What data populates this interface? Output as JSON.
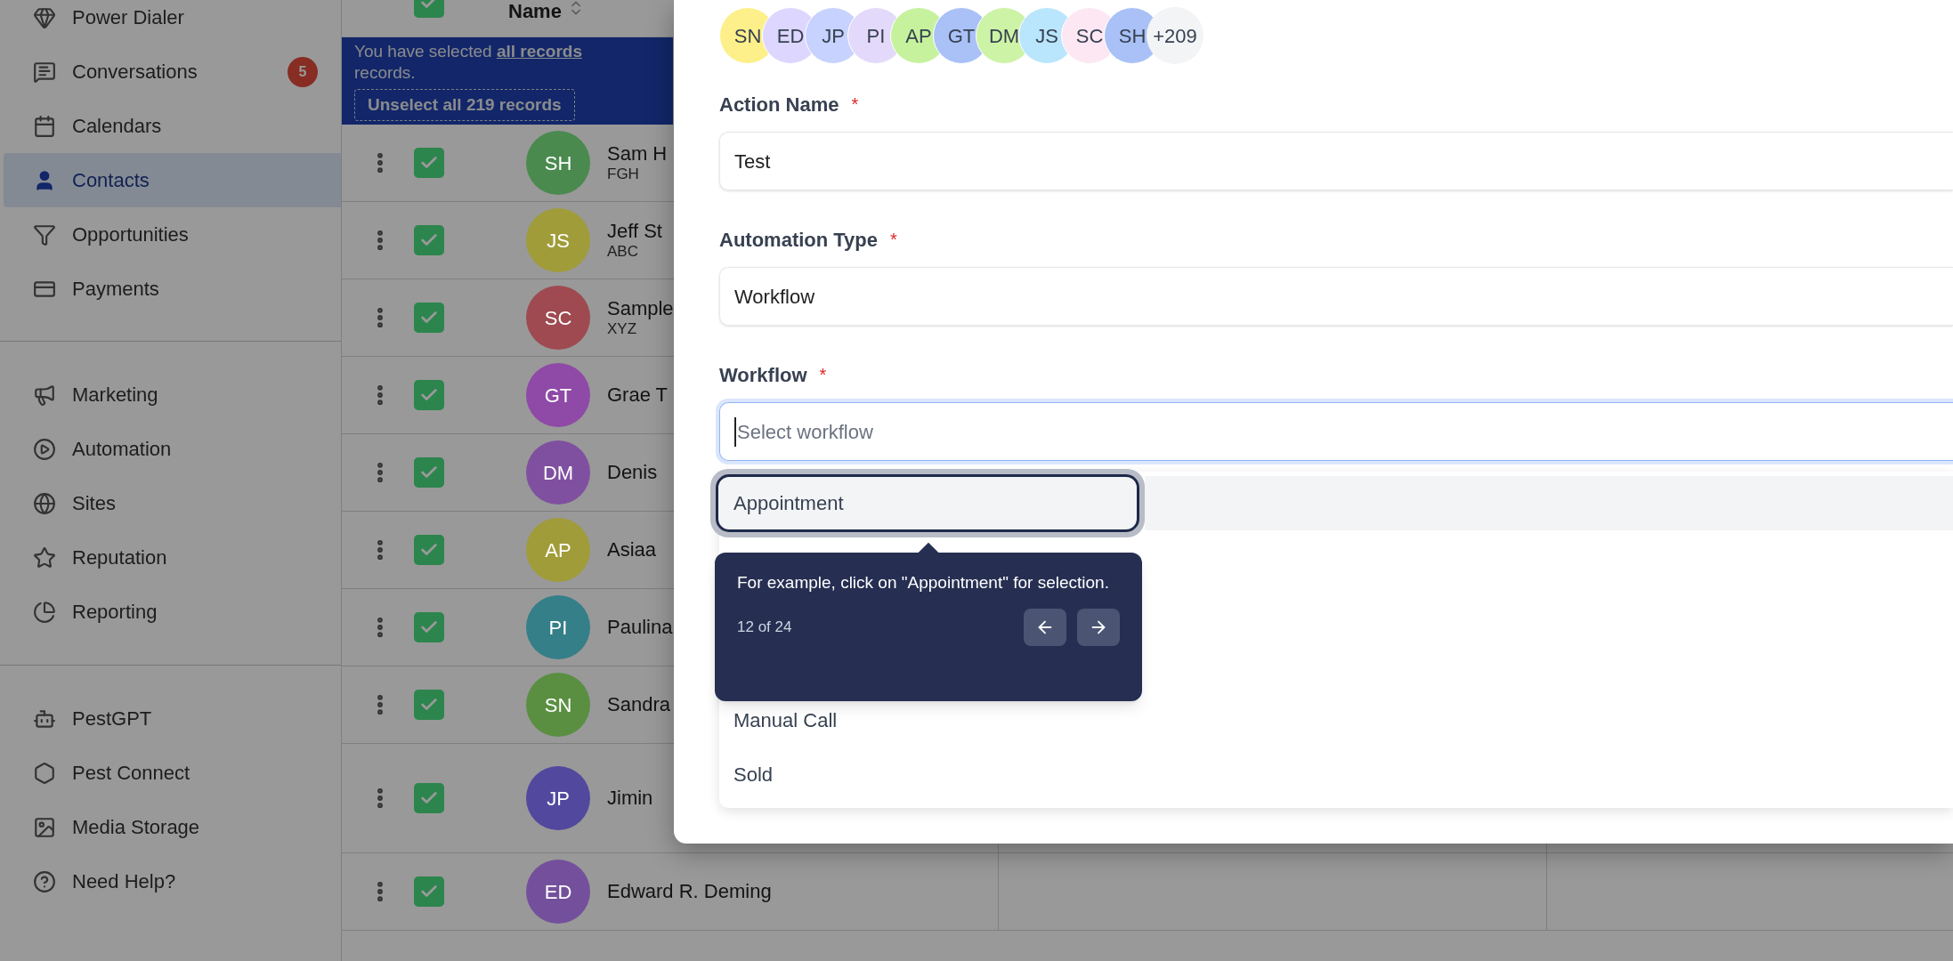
{
  "sidebar": {
    "groups": [
      {
        "items": [
          {
            "label": "Power Dialer",
            "selected": false
          },
          {
            "label": "Conversations",
            "selected": false,
            "badge": "5"
          },
          {
            "label": "Calendars",
            "selected": false
          },
          {
            "label": "Contacts",
            "selected": true
          },
          {
            "label": "Opportunities",
            "selected": false
          },
          {
            "label": "Payments",
            "selected": false
          }
        ]
      },
      {
        "items": [
          {
            "label": "Marketing",
            "selected": false
          },
          {
            "label": "Automation",
            "selected": false
          },
          {
            "label": "Sites",
            "selected": false
          },
          {
            "label": "Reputation",
            "selected": false
          },
          {
            "label": "Reporting",
            "selected": false
          }
        ]
      },
      {
        "items": [
          {
            "label": "PestGPT",
            "selected": false
          },
          {
            "label": "Pest Connect",
            "selected": false
          },
          {
            "label": "Media Storage",
            "selected": false
          },
          {
            "label": "Need Help?",
            "selected": false
          }
        ]
      }
    ]
  },
  "table": {
    "header": {
      "label": "Name",
      "checked": true
    },
    "banner": {
      "text": "You have selected **all records** records.",
      "button": "Unselect all 219 records"
    },
    "rows": [
      {
        "initials": "SH",
        "name": "Sam H",
        "subtitle": "FGH",
        "color": "#4a8a4f",
        "checked": true
      },
      {
        "initials": "JS",
        "name": "Jeff St",
        "subtitle": "ABC",
        "color": "#a09c3a",
        "checked": true
      },
      {
        "initials": "SC",
        "name": "Sample",
        "subtitle": "XYZ",
        "color": "#9e4a50",
        "checked": true
      },
      {
        "initials": "GT",
        "name": "Grae T",
        "color": "#8e4aa6",
        "checked": true
      },
      {
        "initials": "DM",
        "name": "Denis",
        "color": "#8050a0",
        "checked": true
      },
      {
        "initials": "AP",
        "name": "Asiaa",
        "color": "#a09c3a",
        "checked": true
      },
      {
        "initials": "PI",
        "name": "Paulina",
        "color": "#347f88",
        "checked": true
      },
      {
        "initials": "SN",
        "name": "Sandra",
        "color": "#5a8f42",
        "checked": true
      },
      {
        "initials": "JP",
        "name": "Jimin",
        "color": "#52489e",
        "checked": true
      },
      {
        "initials": "ED",
        "name": "Edward R. Deming",
        "color": "#74509c",
        "checked": true
      }
    ]
  },
  "modal": {
    "recipients": [
      {
        "initials": "SN",
        "color": "#fdf08a"
      },
      {
        "initials": "ED",
        "color": "#ddd6fe"
      },
      {
        "initials": "JP",
        "color": "#c7d2fe"
      },
      {
        "initials": "PI",
        "color": "#e3dafb"
      },
      {
        "initials": "AP",
        "color": "#c6f29d"
      },
      {
        "initials": "GT",
        "color": "#a9c1f7"
      },
      {
        "initials": "DM",
        "color": "#cdf3a6"
      },
      {
        "initials": "JS",
        "color": "#bae6fd"
      },
      {
        "initials": "SC",
        "color": "#fce7f3"
      },
      {
        "initials": "SH",
        "color": "#a9c1f7"
      }
    ],
    "more": "+209",
    "fields": [
      {
        "label": "Action Name",
        "required": true,
        "value": "Test",
        "focused": false
      },
      {
        "label": "Automation Type",
        "required": true,
        "value": "Workflow",
        "focused": false
      },
      {
        "label": "Workflow",
        "required": true,
        "placeholder": "Select workflow",
        "focused": true
      }
    ],
    "required_mark": "*",
    "options": [
      {
        "label": "Appointment",
        "highlighted": true
      },
      {
        "label": "Manual Call",
        "highlighted": false
      },
      {
        "label": "Sold",
        "highlighted": false
      }
    ],
    "tooltip": {
      "text": "For example, click on \"Appointment\" for selection.",
      "step": "12 of 24"
    }
  }
}
